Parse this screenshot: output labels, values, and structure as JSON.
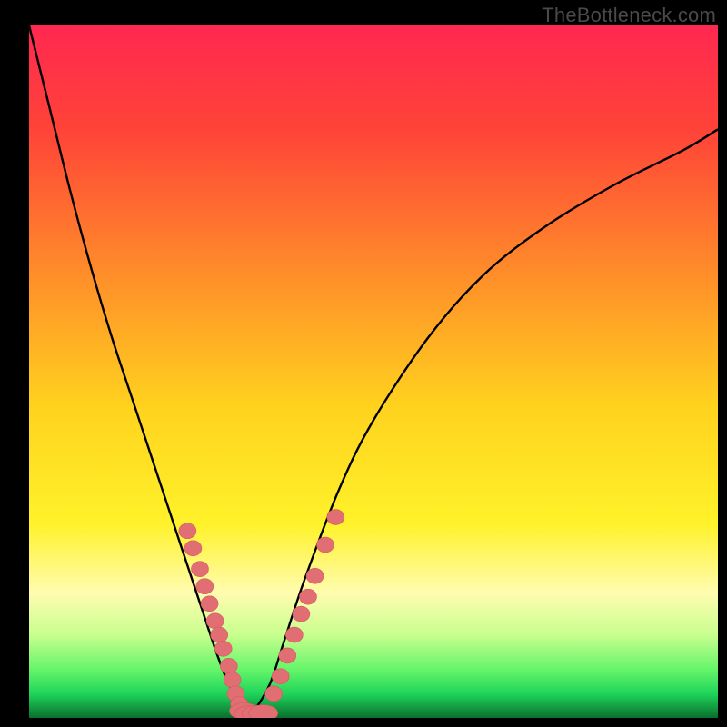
{
  "attribution": "TheBottleneck.com",
  "colors": {
    "frame": "#000000",
    "attribution_text": "#4a4a4a",
    "curve": "#000000",
    "marker_fill": "#e06e72",
    "marker_stroke": "#d45c60",
    "gradient_stops": [
      {
        "offset": 0.0,
        "color": "#ff2850"
      },
      {
        "offset": 0.15,
        "color": "#ff4338"
      },
      {
        "offset": 0.35,
        "color": "#ff8a2a"
      },
      {
        "offset": 0.55,
        "color": "#ffd21e"
      },
      {
        "offset": 0.72,
        "color": "#fff22a"
      },
      {
        "offset": 0.82,
        "color": "#fffcb0"
      },
      {
        "offset": 0.88,
        "color": "#c8ff8e"
      },
      {
        "offset": 0.93,
        "color": "#66f56a"
      },
      {
        "offset": 0.965,
        "color": "#1fd55a"
      },
      {
        "offset": 1.0,
        "color": "#0a6f2e"
      }
    ]
  },
  "chart_data": {
    "type": "line",
    "title": "",
    "xlabel": "",
    "ylabel": "",
    "xlim": [
      0,
      100
    ],
    "ylim": [
      0,
      100
    ],
    "note": "Axes are unlabeled in the source image; values below are normalized 0-100 where 0 is the bottom/left of the gradient area and 100 is the top/right.",
    "series": [
      {
        "name": "bottleneck-curve",
        "x": [
          0.0,
          3.0,
          6.0,
          9.0,
          12.0,
          15.0,
          18.0,
          21.0,
          23.0,
          25.0,
          27.0,
          28.5,
          30.0,
          31.0,
          32.0,
          33.0,
          35.0,
          37.0,
          40.0,
          45.0,
          50.0,
          58.0,
          66.0,
          75.0,
          85.0,
          95.0,
          100.0
        ],
        "y": [
          100.0,
          88.0,
          76.0,
          65.0,
          55.0,
          46.0,
          37.0,
          28.0,
          22.0,
          16.0,
          10.0,
          6.0,
          3.0,
          1.5,
          0.5,
          1.5,
          5.0,
          11.0,
          20.0,
          33.0,
          43.0,
          55.0,
          64.0,
          71.0,
          77.0,
          82.0,
          85.0
        ]
      }
    ],
    "markers": {
      "name": "highlighted-points",
      "shape": "rounded-capsule",
      "points": [
        {
          "x": 23.0,
          "y": 27.0
        },
        {
          "x": 23.8,
          "y": 24.5
        },
        {
          "x": 24.8,
          "y": 21.5
        },
        {
          "x": 25.5,
          "y": 19.0
        },
        {
          "x": 26.2,
          "y": 16.5
        },
        {
          "x": 27.0,
          "y": 14.0
        },
        {
          "x": 27.6,
          "y": 12.0
        },
        {
          "x": 28.2,
          "y": 10.0
        },
        {
          "x": 29.0,
          "y": 7.5
        },
        {
          "x": 29.5,
          "y": 5.5
        },
        {
          "x": 30.0,
          "y": 3.5
        },
        {
          "x": 30.5,
          "y": 2.0
        },
        {
          "x": 31.2,
          "y": 1.0
        },
        {
          "x": 32.0,
          "y": 0.6
        },
        {
          "x": 33.0,
          "y": 0.6
        },
        {
          "x": 34.0,
          "y": 0.7
        },
        {
          "x": 35.5,
          "y": 3.5
        },
        {
          "x": 36.5,
          "y": 6.0
        },
        {
          "x": 37.5,
          "y": 9.0
        },
        {
          "x": 38.5,
          "y": 12.0
        },
        {
          "x": 39.5,
          "y": 15.0
        },
        {
          "x": 40.5,
          "y": 17.5
        },
        {
          "x": 41.5,
          "y": 20.5
        },
        {
          "x": 43.0,
          "y": 25.0
        },
        {
          "x": 44.5,
          "y": 29.0
        }
      ]
    }
  }
}
